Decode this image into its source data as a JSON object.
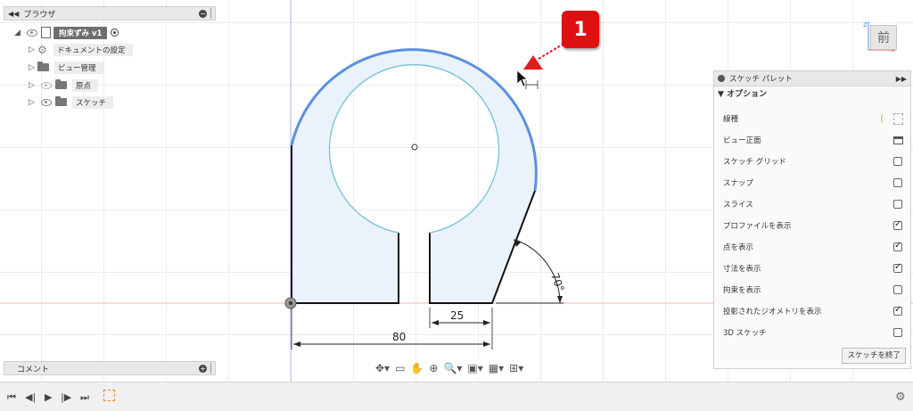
{
  "browser": {
    "title": "ブラウザ",
    "root": "拘束ずみ v1",
    "items": [
      {
        "label": "ドキュメントの設定"
      },
      {
        "label": "ビュー管理"
      },
      {
        "label": "原点"
      },
      {
        "label": "スケッチ"
      }
    ]
  },
  "comment": {
    "title": "コメント"
  },
  "viewcube": {
    "face_label": "前",
    "z_label": "Z",
    "x_label": "X"
  },
  "callout": {
    "number": "1"
  },
  "dimensions": {
    "width": "80",
    "gap": "25",
    "angle": "70°"
  },
  "palette": {
    "title": "スケッチ パレット",
    "section": "オプション",
    "rows": [
      {
        "label": "線種"
      },
      {
        "label": "ビュー正面"
      },
      {
        "label": "スケッチ グリッド",
        "checked": false
      },
      {
        "label": "スナップ",
        "checked": false
      },
      {
        "label": "スライス",
        "checked": false
      },
      {
        "label": "プロファイルを表示",
        "checked": true
      },
      {
        "label": "点を表示",
        "checked": true
      },
      {
        "label": "寸法を表示",
        "checked": true
      },
      {
        "label": "拘束を表示",
        "checked": false
      },
      {
        "label": "投影されたジオメトリを表示",
        "checked": true
      },
      {
        "label": "3D スケッチ",
        "checked": false
      }
    ],
    "finish_button": "スケッチを終了"
  },
  "colors": {
    "profile_fill": "#eaf3fb",
    "selected_arc": "#5b8fe0",
    "circle": "#7cc4d9",
    "callout": "#dd1111"
  }
}
